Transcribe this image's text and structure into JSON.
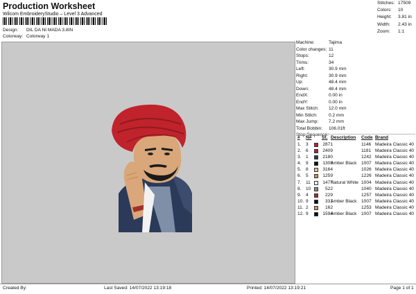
{
  "header": {
    "title": "Production Worksheet",
    "subtitle": "Wilcom EmbroideryStudio – Level 3 Advanced",
    "barcode_suffix": ",",
    "design_label": "Design:",
    "design_value": "DIL DA NI MADA 3.8IN",
    "colorway_label": "Colorway:",
    "colorway_value": "Colorway 1"
  },
  "stats": [
    {
      "k": "Stitches:",
      "v": "17509"
    },
    {
      "k": "Colors:",
      "v": "10"
    },
    {
      "k": "Height:",
      "v": "3.81 in"
    },
    {
      "k": "Width:",
      "v": "2.43 in"
    },
    {
      "k": "Zoom:",
      "v": "1:1"
    }
  ],
  "machine": [
    {
      "k": "Machine:",
      "v": "Tajima"
    },
    {
      "k": "Color changes:",
      "v": "11"
    },
    {
      "k": "Stops:",
      "v": "12"
    },
    {
      "k": "Trims:",
      "v": "34"
    },
    {
      "k": "Left:",
      "v": "30.9 mm"
    },
    {
      "k": "Right:",
      "v": "30.9 mm"
    },
    {
      "k": "Up:",
      "v": "48.4 mm"
    },
    {
      "k": "Down:",
      "v": "48.4 mm"
    },
    {
      "k": "EndX:",
      "v": "0.00 in"
    },
    {
      "k": "EndY:",
      "v": "0.00 in"
    },
    {
      "k": "Max Stitch:",
      "v": "12.0 mm"
    },
    {
      "k": "Min Stitch:",
      "v": "0.2 mm"
    },
    {
      "k": "Max Jump:",
      "v": "7.2 mm"
    },
    {
      "k": "Total Bobbin:",
      "v": "106.01ft"
    }
  ],
  "sequence": {
    "label": "Stop Sequence:",
    "headers": [
      "#",
      "N#",
      "St.",
      "Description",
      "Code",
      "Brand"
    ],
    "rows": [
      {
        "n": "1.",
        "needle": "3",
        "st": "2871",
        "desc": "",
        "code": "1146",
        "brand": "Madeira Classic 40",
        "color": "#c0232b"
      },
      {
        "n": "2.",
        "needle": "6",
        "st": "2409",
        "desc": "",
        "code": "1181",
        "brand": "Madeira Classic 40",
        "color": "#b0232d"
      },
      {
        "n": "3.",
        "needle": "1",
        "st": "2180",
        "desc": "",
        "code": "1242",
        "brand": "Madeira Classic 40",
        "color": "#2b3a59"
      },
      {
        "n": "4.",
        "needle": "9",
        "st": "1309",
        "desc": "Amber Black",
        "code": "1007",
        "brand": "Madeira Classic 40",
        "color": "#111111"
      },
      {
        "n": "5.",
        "needle": "8",
        "st": "3164",
        "desc": "",
        "code": "1026",
        "brand": "Madeira Classic 40",
        "color": "#e6b98c"
      },
      {
        "n": "6.",
        "needle": "5",
        "st": "1259",
        "desc": "",
        "code": "1226",
        "brand": "Madeira Classic 40",
        "color": "#c98e5c"
      },
      {
        "n": "7.",
        "needle": "11",
        "st": "1477",
        "desc": "Natural White",
        "code": "1004",
        "brand": "Madeira Classic 40",
        "color": "#f7f7f7"
      },
      {
        "n": "8.",
        "needle": "10",
        "st": "522",
        "desc": "",
        "code": "1040",
        "brand": "Madeira Classic 40",
        "color": "#8a8a8a"
      },
      {
        "n": "9.",
        "needle": "4",
        "st": "229",
        "desc": "",
        "code": "1257",
        "brand": "Madeira Classic 40",
        "color": "#a1302a"
      },
      {
        "n": "10.",
        "needle": "9",
        "st": "331",
        "desc": "Amber Black",
        "code": "1007",
        "brand": "Madeira Classic 40",
        "color": "#111111"
      },
      {
        "n": "11.",
        "needle": "2",
        "st": "162",
        "desc": "",
        "code": "1253",
        "brand": "Madeira Classic 40",
        "color": "#d8905f"
      },
      {
        "n": "12.",
        "needle": "9",
        "st": "1594",
        "desc": "Amber Black",
        "code": "1007",
        "brand": "Madeira Classic 40",
        "color": "#111111"
      }
    ]
  },
  "footer": {
    "created": "Created By:",
    "saved": "Last Saved: 14/07/2022 13:19:18",
    "printed": "Printed: 14/07/2022 13:19:21",
    "page": "Page 1 of 1"
  },
  "colors": {
    "design_bg": "#c9c9c9",
    "turban": "#c0232b",
    "jacket": "#2b3a59",
    "skin": "#d9a77a"
  }
}
